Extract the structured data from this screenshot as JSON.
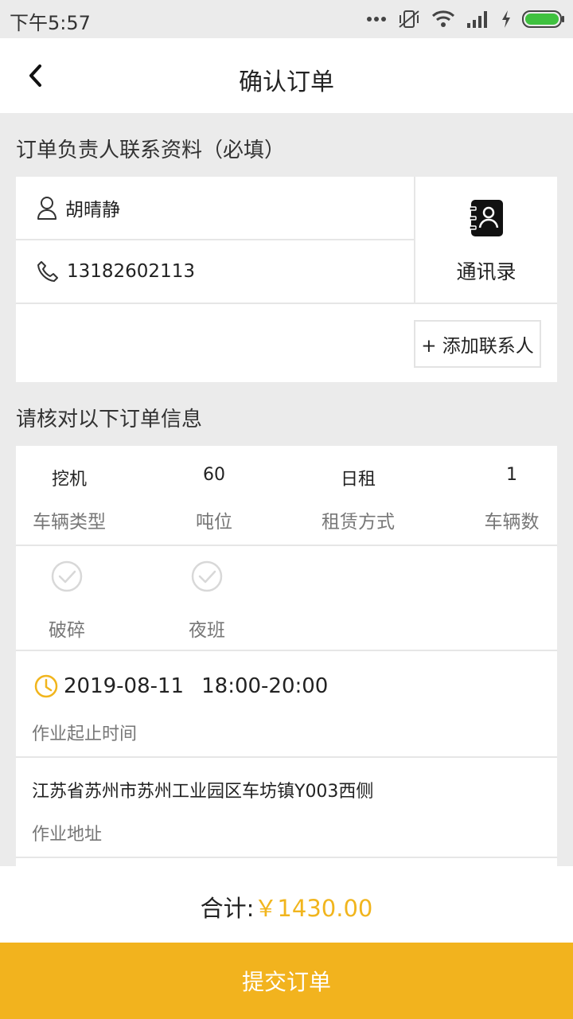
{
  "status_bar": {
    "time": "下午5:57"
  },
  "nav": {
    "title": "确认订单"
  },
  "contact_section": {
    "title": "订单负责人联系资料（必填）",
    "name": "胡晴静",
    "phone": "13182602113",
    "contacts_book_label": "通讯录",
    "add_contact_label": "+ 添加联系人"
  },
  "order_section": {
    "title": "请核对以下订单信息",
    "specs": [
      {
        "value": "挖机",
        "label": "车辆类型"
      },
      {
        "value": "60",
        "label": "吨位"
      },
      {
        "value": "日租",
        "label": "租赁方式"
      },
      {
        "value": "1",
        "label": "车辆数"
      }
    ],
    "options": [
      {
        "label": "破碎"
      },
      {
        "label": "夜班"
      }
    ],
    "work_date": "2019-08-11",
    "work_time": "18:00-20:00",
    "work_time_label": "作业起止时间",
    "address": "江苏省苏州市苏州工业园区车坊镇Y003西侧",
    "address_label": "作业地址"
  },
  "footer": {
    "total_label": "合计:",
    "total_value": "￥1430.00",
    "submit_label": "提交订单"
  },
  "colors": {
    "accent": "#f2b31e",
    "price": "#f1b51d",
    "background": "#ebebeb"
  }
}
